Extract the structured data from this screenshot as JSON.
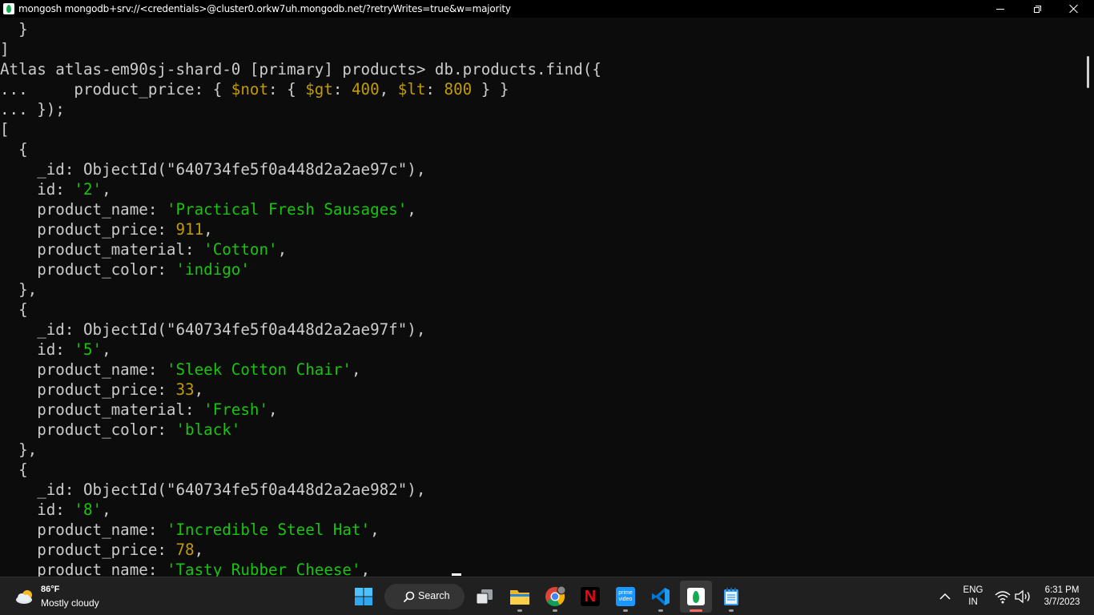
{
  "window": {
    "title": "mongosh mongodb+srv://<credentials>@cluster0.orkw7uh.mongodb.net/?retryWrites=true&w=majority"
  },
  "console": {
    "lines": [
      [
        {
          "t": "  }"
        }
      ],
      [
        {
          "t": "]"
        }
      ],
      [
        {
          "t": "Atlas atlas-em90sj-shard-0 [primary] products> db.products.find({"
        }
      ],
      [
        {
          "t": "...     product_price: { "
        },
        {
          "t": "$not",
          "c": "y"
        },
        {
          "t": ": { "
        },
        {
          "t": "$gt",
          "c": "y"
        },
        {
          "t": ": "
        },
        {
          "t": "400",
          "c": "y"
        },
        {
          "t": ", "
        },
        {
          "t": "$lt",
          "c": "y"
        },
        {
          "t": ": "
        },
        {
          "t": "800",
          "c": "y"
        },
        {
          "t": " } }"
        }
      ],
      [
        {
          "t": "... });"
        }
      ],
      [
        {
          "t": "["
        }
      ],
      [
        {
          "t": "  {"
        }
      ],
      [
        {
          "t": "    _id: ObjectId(\"640734fe5f0a448d2a2ae97c\"),"
        }
      ],
      [
        {
          "t": "    id: "
        },
        {
          "t": "'2'",
          "c": "g"
        },
        {
          "t": ","
        }
      ],
      [
        {
          "t": "    product_name: "
        },
        {
          "t": "'Practical Fresh Sausages'",
          "c": "g"
        },
        {
          "t": ","
        }
      ],
      [
        {
          "t": "    product_price: "
        },
        {
          "t": "911",
          "c": "y"
        },
        {
          "t": ","
        }
      ],
      [
        {
          "t": "    product_material: "
        },
        {
          "t": "'Cotton'",
          "c": "g"
        },
        {
          "t": ","
        }
      ],
      [
        {
          "t": "    product_color: "
        },
        {
          "t": "'indigo'",
          "c": "g"
        }
      ],
      [
        {
          "t": "  },"
        }
      ],
      [
        {
          "t": "  {"
        }
      ],
      [
        {
          "t": "    _id: ObjectId(\"640734fe5f0a448d2a2ae97f\"),"
        }
      ],
      [
        {
          "t": "    id: "
        },
        {
          "t": "'5'",
          "c": "g"
        },
        {
          "t": ","
        }
      ],
      [
        {
          "t": "    product_name: "
        },
        {
          "t": "'Sleek Cotton Chair'",
          "c": "g"
        },
        {
          "t": ","
        }
      ],
      [
        {
          "t": "    product_price: "
        },
        {
          "t": "33",
          "c": "y"
        },
        {
          "t": ","
        }
      ],
      [
        {
          "t": "    product_material: "
        },
        {
          "t": "'Fresh'",
          "c": "g"
        },
        {
          "t": ","
        }
      ],
      [
        {
          "t": "    product_color: "
        },
        {
          "t": "'black'",
          "c": "g"
        }
      ],
      [
        {
          "t": "  },"
        }
      ],
      [
        {
          "t": "  {"
        }
      ],
      [
        {
          "t": "    _id: ObjectId(\"640734fe5f0a448d2a2ae982\"),"
        }
      ],
      [
        {
          "t": "    id: "
        },
        {
          "t": "'8'",
          "c": "g"
        },
        {
          "t": ","
        }
      ],
      [
        {
          "t": "    product_name: "
        },
        {
          "t": "'Incredible Steel Hat'",
          "c": "g"
        },
        {
          "t": ","
        }
      ],
      [
        {
          "t": "    product_price: "
        },
        {
          "t": "78",
          "c": "y"
        },
        {
          "t": ","
        }
      ],
      [
        {
          "t": "    product_name: "
        },
        {
          "t": "'Tasty Rubber Cheese'",
          "c": "g"
        },
        {
          "t": ","
        }
      ]
    ]
  },
  "taskbar": {
    "weather": {
      "temp": "86°F",
      "desc": "Mostly cloudy",
      "icon": "cloudy-sun-icon"
    },
    "search_label": "Search",
    "apps": [
      {
        "name": "windows-start-icon"
      },
      {
        "name": "search-icon"
      },
      {
        "name": "task-view-icon"
      },
      {
        "name": "file-explorer-icon"
      },
      {
        "name": "chrome-icon"
      },
      {
        "name": "netflix-icon"
      },
      {
        "name": "prime-video-icon"
      },
      {
        "name": "vscode-icon"
      },
      {
        "name": "mongodb-icon"
      },
      {
        "name": "notepad-icon"
      }
    ],
    "netflix_letter": "N",
    "prime_label_top": "prime",
    "prime_label_bottom": "video",
    "lang_top": "ENG",
    "lang_bottom": "IN",
    "time": "6:31 PM",
    "date": "3/7/2023"
  },
  "colors": {
    "string_green": "#16c60c",
    "number_yellow": "#c19c00",
    "text_default": "#cccccc",
    "console_bg": "#0c0c0c",
    "taskbar_bg": "#202020",
    "mongo_green": "#13aa52"
  }
}
